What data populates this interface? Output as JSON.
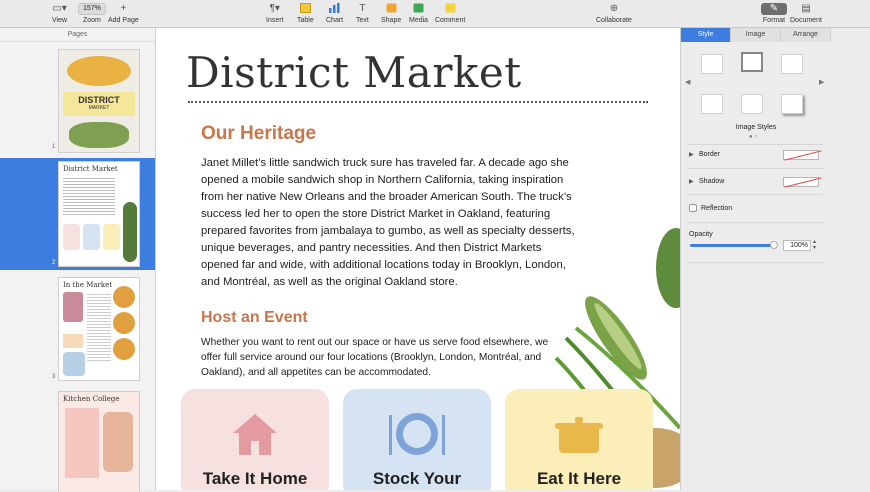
{
  "toolbar": {
    "view": "View",
    "zoom_value": "157%",
    "zoom": "Zoom",
    "add_page": "Add Page",
    "insert": "Insert",
    "table": "Table",
    "chart": "Chart",
    "text": "Text",
    "shape": "Shape",
    "media": "Media",
    "comment": "Comment",
    "collaborate": "Collaborate",
    "format": "Format",
    "document": "Document"
  },
  "sidebar": {
    "header": "Pages",
    "pages": [
      {
        "num": "1",
        "title": "DISTRICT",
        "subtitle": "MARKET"
      },
      {
        "num": "2",
        "title": "District Market"
      },
      {
        "num": "3",
        "title": "In the Market"
      },
      {
        "num": "",
        "title": "Kitchen College"
      }
    ]
  },
  "document": {
    "title": "District Market",
    "heritage_heading": "Our Heritage",
    "heritage_lines": [
      "Janet Millet’s little sandwich truck sure has traveled far. A decade ago she",
      "opened a mobile sandwich shop in Northern California, taking inspiration",
      "from her native New Orleans and the broader American South. The truck’s",
      "success led her to open the store District Market in Oakland, featuring",
      "prepared favorites from jambalaya to gumbo, as well as specialty desserts,",
      "unique beverages, and pantry necessities. And then District Markets",
      "opened far and wide, with additional locations today in Brooklyn, London,",
      "and Montréal, as well as the original Oakland store."
    ],
    "event_heading": "Host an Event",
    "event_lines": [
      "Whether you want to rent out our space or have us serve food elsewhere, we",
      "offer full service around our four locations (Brooklyn, London, Montréal, and",
      "Oakland), and all appetites can be accommodated."
    ],
    "cards": [
      {
        "label": "Take It Home",
        "color": "#f6e0e0",
        "icon": "house-icon"
      },
      {
        "label": "Stock Your",
        "color": "#d6e3f2",
        "icon": "plate-icon"
      },
      {
        "label": "Eat It Here",
        "color": "#fbeeb8",
        "icon": "pot-icon"
      }
    ]
  },
  "inspector": {
    "tabs": [
      "Style",
      "Image",
      "Arrange"
    ],
    "image_styles_label": "Image Styles",
    "border": "Border",
    "shadow": "Shadow",
    "reflection": "Reflection",
    "opacity": "Opacity",
    "opacity_value": "100%"
  }
}
